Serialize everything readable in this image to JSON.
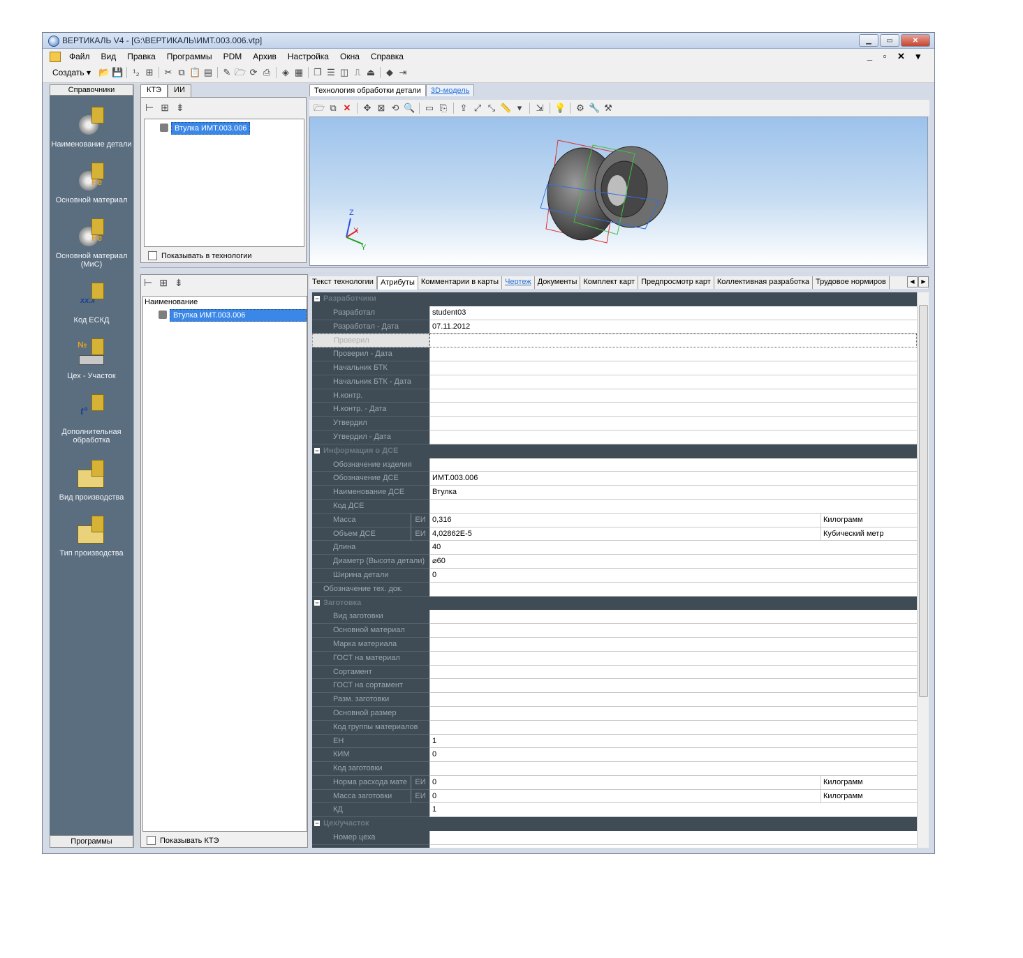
{
  "window": {
    "title": "ВЕРТИКАЛЬ V4 - [G:\\ВЕРТИКАЛЬ\\ИМТ.003.006.vtp]"
  },
  "menu": [
    "Файл",
    "Вид",
    "Правка",
    "Программы",
    "PDM",
    "Архив",
    "Настройка",
    "Окна",
    "Справка"
  ],
  "toolbar": {
    "create_label": "Создать"
  },
  "left_panel": {
    "header": "Справочники",
    "footer": "Программы",
    "items": [
      "Наименование детали",
      "Основной материал",
      "Основной материал (МиС)",
      "Код ЕСКД",
      "Цех - Участок",
      "Дополнительная обработка",
      "Вид производства",
      "Тип производства"
    ]
  },
  "tree_top": {
    "tabs": [
      "КТЭ",
      "ИИ"
    ],
    "node": "Втулка ИМТ.003.006",
    "checkbox": "Показывать в технологии"
  },
  "tree_bottom": {
    "header": "Наименование",
    "node": "Втулка ИМТ.003.006",
    "checkbox": "Показывать КТЭ"
  },
  "right_tabs_top": [
    "Технология обработки детали",
    "3D-модель"
  ],
  "right_tabs_mid": [
    "Текст технологии",
    "Атрибуты",
    "Комментарии в карты",
    "Чертеж",
    "Документы",
    "Комплект карт",
    "Предпросмотр карт",
    "Коллективная разработка",
    "Трудовое нормиров"
  ],
  "axis_labels": {
    "z": "Z",
    "x": "X",
    "y": "Y"
  },
  "colors": {
    "selection": "#3a87e8",
    "category": "#3f4b55",
    "link": "#2b6fd4"
  },
  "grid": {
    "categories": [
      {
        "name": "Разработчики",
        "rows": [
          {
            "label": "Разработал",
            "value": "student03"
          },
          {
            "label": "Разработал - Дата",
            "value": "07.11.2012"
          },
          {
            "label": "Проверил",
            "value": ""
          },
          {
            "label": "Проверил - Дата",
            "value": ""
          },
          {
            "label": "Начальник БТК",
            "value": ""
          },
          {
            "label": "Начальник БТК - Дата",
            "value": ""
          },
          {
            "label": "Н.контр.",
            "value": ""
          },
          {
            "label": "Н.контр. - Дата",
            "value": ""
          },
          {
            "label": "Утвердил",
            "value": ""
          },
          {
            "label": "Утвердил - Дата",
            "value": ""
          }
        ]
      },
      {
        "name": "Информация о ДСЕ",
        "rows": [
          {
            "label": "Обозначение изделия",
            "value": ""
          },
          {
            "label": "Обозначение ДСЕ",
            "value": "ИМТ.003.006"
          },
          {
            "label": "Наименование ДСЕ",
            "value": "Втулка"
          },
          {
            "label": "Код ДСЕ",
            "value": ""
          },
          {
            "label": "Масса",
            "ei": "ЕИ",
            "value": "0,316",
            "unit": "Килограмм"
          },
          {
            "label": "Объем ДСЕ",
            "ei": "ЕИ",
            "value": "4,02862E-5",
            "unit": "Кубический метр"
          },
          {
            "label": "Длина",
            "value": "40"
          },
          {
            "label": "Диаметр (Высота детали)",
            "value": "⌀60"
          },
          {
            "label": "Ширина детали",
            "value": "0"
          },
          {
            "label": "Обозначение тех. док.",
            "value": ""
          }
        ]
      },
      {
        "name": "Заготовка",
        "rows": [
          {
            "label": "Вид заготовки",
            "value": ""
          },
          {
            "label": "Основной материал",
            "value": ""
          },
          {
            "label": "Марка материала",
            "value": ""
          },
          {
            "label": "ГОСТ на материал",
            "value": ""
          },
          {
            "label": "Сортамент",
            "value": ""
          },
          {
            "label": "ГОСТ на сортамент",
            "value": ""
          },
          {
            "label": "Разм. заготовки",
            "value": ""
          },
          {
            "label": "Основной размер",
            "value": ""
          },
          {
            "label": "Код группы материалов",
            "value": ""
          },
          {
            "label": "ЕН",
            "value": "1"
          },
          {
            "label": "КИМ",
            "value": "0"
          },
          {
            "label": "Код заготовки",
            "value": ""
          },
          {
            "label": "Норма расхода мате",
            "ei": "ЕИ",
            "value": "0",
            "unit": "Килограмм"
          },
          {
            "label": "Масса заготовки",
            "ei": "ЕИ",
            "value": "0",
            "unit": "Килограмм"
          },
          {
            "label": "КД",
            "value": "1"
          }
        ]
      },
      {
        "name": "Цех/участок",
        "rows": [
          {
            "label": "Номер цеха",
            "value": ""
          },
          {
            "label": "Номер участка",
            "value": ""
          }
        ]
      }
    ]
  }
}
